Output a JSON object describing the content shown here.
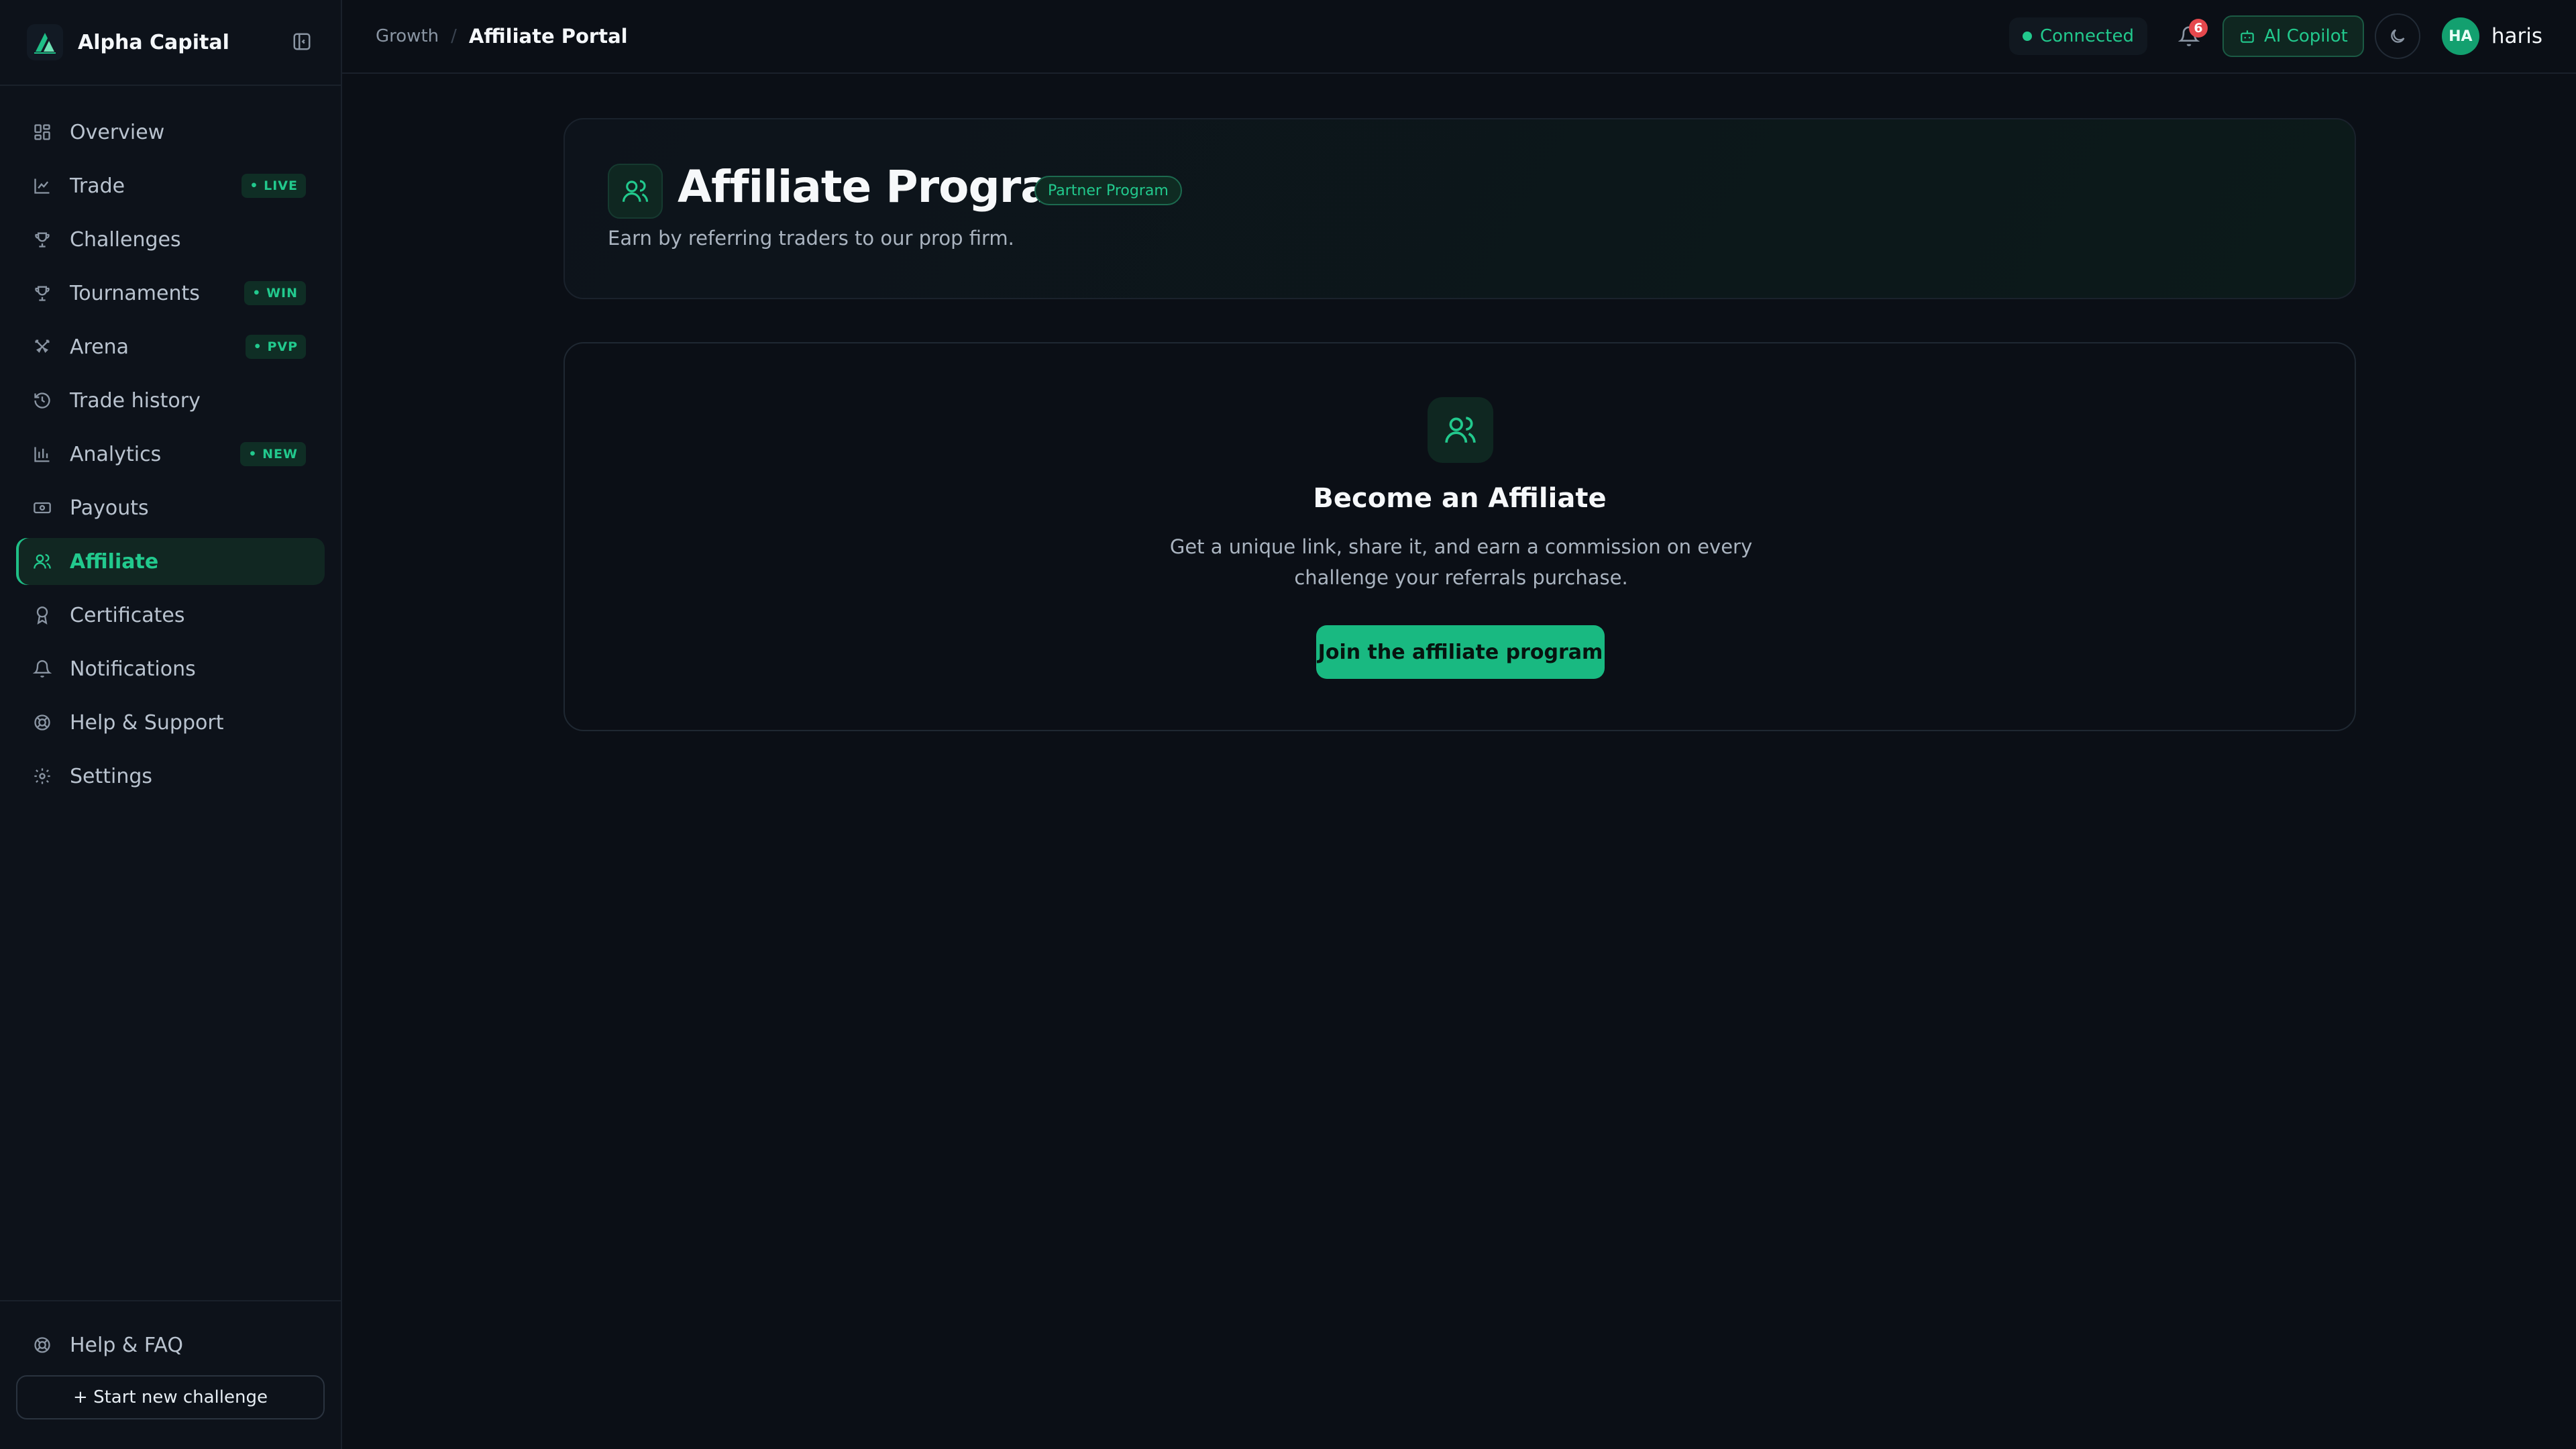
{
  "brand": {
    "name": "Alpha Capital"
  },
  "sidebar": {
    "items": [
      {
        "label": "Overview",
        "icon": "grid-icon"
      },
      {
        "label": "Trade",
        "icon": "chart-icon",
        "badge": "LIVE"
      },
      {
        "label": "Challenges",
        "icon": "trophy-icon"
      },
      {
        "label": "Tournaments",
        "icon": "trophy-icon",
        "badge": "WIN"
      },
      {
        "label": "Arena",
        "icon": "swords-icon",
        "badge": "PVP"
      },
      {
        "label": "Trade history",
        "icon": "history-icon"
      },
      {
        "label": "Analytics",
        "icon": "bar-chart-icon",
        "badge": "NEW"
      },
      {
        "label": "Payouts",
        "icon": "banknote-icon"
      },
      {
        "label": "Affiliate",
        "icon": "users-icon",
        "active": true
      },
      {
        "label": "Certificates",
        "icon": "award-icon"
      },
      {
        "label": "Notifications",
        "icon": "bell-icon"
      },
      {
        "label": "Help & Support",
        "icon": "lifebuoy-icon"
      },
      {
        "label": "Settings",
        "icon": "gear-icon"
      }
    ],
    "bottom": {
      "help_label": "Help & FAQ",
      "start_label": "+ Start new challenge"
    }
  },
  "header": {
    "breadcrumb_parent": "Growth",
    "breadcrumb_current": "Affiliate Portal",
    "connection": "Connected",
    "notification_count": "6",
    "copilot_label": "AI Copilot",
    "avatar_initials": "HA",
    "username": "haris"
  },
  "hero": {
    "title": "Affiliate Program",
    "pill": "Partner Program",
    "subtitle": "Earn by referring traders to our prop firm."
  },
  "join": {
    "title": "Become an Affiliate",
    "description": "Get a unique link, share it, and earn a commission on every challenge your referrals purchase.",
    "button": "Join the affiliate program"
  },
  "colors": {
    "accent": "#22c98d",
    "background": "#0b0f16",
    "sidebar": "#0d121a",
    "notification": "#e5484d"
  }
}
